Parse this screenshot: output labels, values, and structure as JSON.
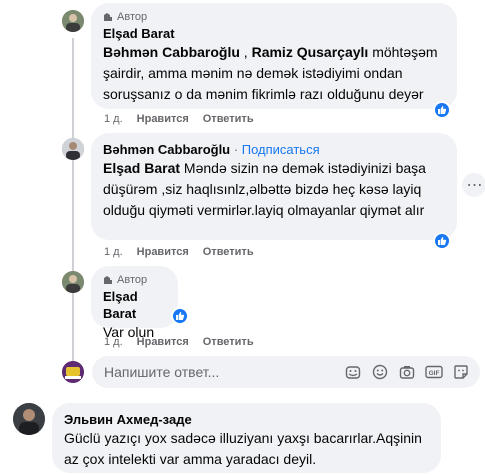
{
  "comments": [
    {
      "author": "Elşad Barat",
      "badge": "Автор",
      "mentions": [
        "Bəhmən Cabbaroğlu",
        "Ramiz Qusarçaylı"
      ],
      "separator": ",",
      "text_line1_rest": " möhtəşəm",
      "text_rest": "şairdir, amma mənim nə deməK istədiyimi ondan soruşsanız o da mənim fikrimlə razı olduğunu deyər",
      "time": "1 д.",
      "like_label": "Нравится",
      "reply_label": "Ответить"
    },
    {
      "author": "Bəhmən Cabbaroğlu",
      "dot": "·",
      "subscribe": "Подписаться",
      "mention": "Elşad Barat",
      "text": " Məndə sizin nə demək istədiyinizi başa düşürəm ,siz haqlısınlz,əlbəttə bizdə heç kəsə layiq olduğu qiyməti vermirlər.layiq olmayanlar qiymət alır",
      "time": "1 д.",
      "like_label": "Нравится",
      "reply_label": "Ответить"
    },
    {
      "author": "Elşad Barat",
      "badge": "Автор",
      "text": "Var olun",
      "time": "1 д.",
      "like_label": "Нравится",
      "reply_label": "Ответить"
    }
  ],
  "reply_box": {
    "placeholder": "Напишите ответ..."
  },
  "bottom_comment": {
    "author": "Эльвин Ахмед-заде",
    "text": "Güclü yazıçı yox sadəcə illuziyanı yaxşı bacarırlar.Aqşinin az çox intelekti var amma yaradacı deyil."
  },
  "colors": {
    "accent": "#1877f2",
    "bubble": "#f0f2f5",
    "secondary_text": "#65676b"
  },
  "icons": [
    "author-badge-icon",
    "like-reaction-icon",
    "more-options-icon",
    "sticker-icon",
    "emoji-icon",
    "camera-icon",
    "gif-icon",
    "avatar-sticker-icon"
  ]
}
